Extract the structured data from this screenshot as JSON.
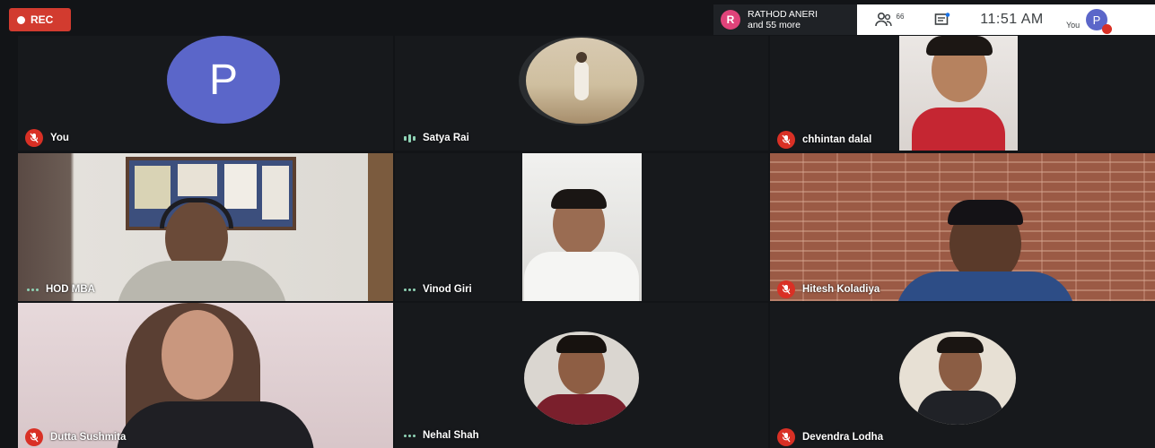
{
  "recording": {
    "label": "REC"
  },
  "presenter": {
    "initial": "R",
    "name": "RATHOD ANERI",
    "more": "and 55 more"
  },
  "topbar": {
    "people_count": "66",
    "time": "11:51 AM",
    "self_label": "You",
    "self_initial": "P"
  },
  "participants": [
    {
      "name": "You",
      "status": "muted",
      "initial": "P"
    },
    {
      "name": "Satya Rai",
      "status": "speaking"
    },
    {
      "name": "chhintan dalal",
      "status": "muted"
    },
    {
      "name": "HOD MBA",
      "status": "dots"
    },
    {
      "name": "Vinod Giri",
      "status": "dots"
    },
    {
      "name": "Hitesh Koladiya",
      "status": "muted"
    },
    {
      "name": "Dutta Sushmita",
      "status": "muted"
    },
    {
      "name": "Nehal Shah",
      "status": "dots"
    },
    {
      "name": "Devendra Lodha",
      "status": "muted"
    }
  ],
  "colors": {
    "muted_red": "#d93025",
    "avatar_blue": "#5b66c9",
    "rec_red": "#d23b2f"
  }
}
